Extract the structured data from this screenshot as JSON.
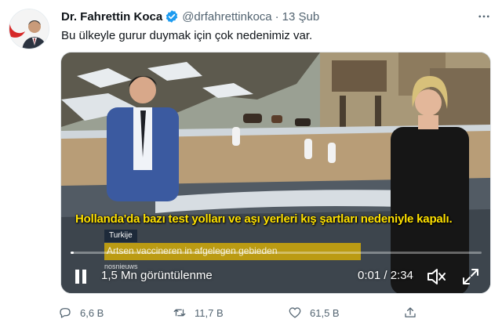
{
  "tweet": {
    "author_name": "Dr. Fahrettin Koca",
    "author_handle": "@drfahrettinkoca",
    "separator": "·",
    "date": "13 Şub",
    "text": "Bu ülkeyle gurur duymak için çok nedenimiz var."
  },
  "video": {
    "subtitle": "Hollanda'da bazı test yolları ve aşı yerleri kış şartları nedeniyle kapalı.",
    "country_tag": "Turkije",
    "dutch_caption": "Artsen vaccineren in afgelegen gebieden",
    "channel_tag": "nosnieuws",
    "views": "1,5 Mn görüntülenme",
    "time_display": "0:01 / 2:34",
    "progress_fraction": 0.007
  },
  "actions": {
    "reply_count": "6,6 B",
    "retweet_count": "11,7 B",
    "like_count": "61,5 B"
  },
  "icons": {
    "verified": "verified-badge-icon",
    "more": "more-options-icon",
    "play_pause": "pause-icon",
    "mute": "mute-icon",
    "fullscreen": "fullscreen-icon",
    "reply": "reply-icon",
    "retweet": "retweet-icon",
    "like": "like-icon",
    "share": "share-icon"
  },
  "colors": {
    "verified_blue": "#1d9bf0",
    "secondary_text": "#536471",
    "subtitle_yellow": "#ffe100"
  }
}
